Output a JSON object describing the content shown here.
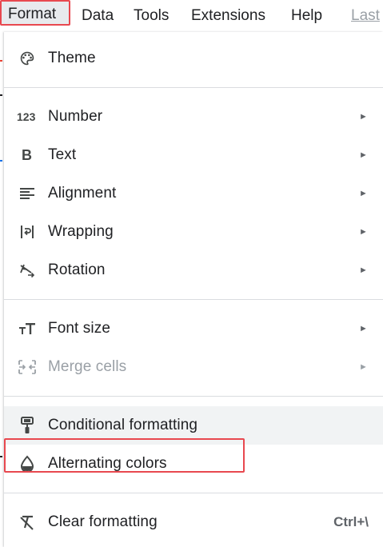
{
  "menubar": {
    "items": [
      "Format",
      "Data",
      "Tools",
      "Extensions",
      "Help",
      "Last"
    ]
  },
  "menu": {
    "items": [
      {
        "label": "Theme",
        "icon": "palette-icon"
      },
      {
        "label": "Number",
        "icon": "number-123-icon",
        "submenu": true
      },
      {
        "label": "Text",
        "icon": "bold-b-icon",
        "submenu": true
      },
      {
        "label": "Alignment",
        "icon": "align-left-icon",
        "submenu": true
      },
      {
        "label": "Wrapping",
        "icon": "text-wrap-icon",
        "submenu": true
      },
      {
        "label": "Rotation",
        "icon": "text-rotation-icon",
        "submenu": true
      },
      {
        "label": "Font size",
        "icon": "font-size-icon",
        "submenu": true
      },
      {
        "label": "Merge cells",
        "icon": "merge-cells-icon",
        "submenu": true,
        "disabled": true
      },
      {
        "label": "Conditional formatting",
        "icon": "paint-roller-icon",
        "highlighted": true
      },
      {
        "label": "Alternating colors",
        "icon": "water-drop-icon"
      },
      {
        "label": "Clear formatting",
        "icon": "clear-format-icon",
        "shortcut": "Ctrl+\\"
      }
    ],
    "submenu_arrow": "►"
  },
  "colors": {
    "highlight_border": "#e8484f",
    "hover_bg": "#f1f3f4",
    "separator": "#dadce0",
    "disabled_text": "#9aa0a6"
  }
}
